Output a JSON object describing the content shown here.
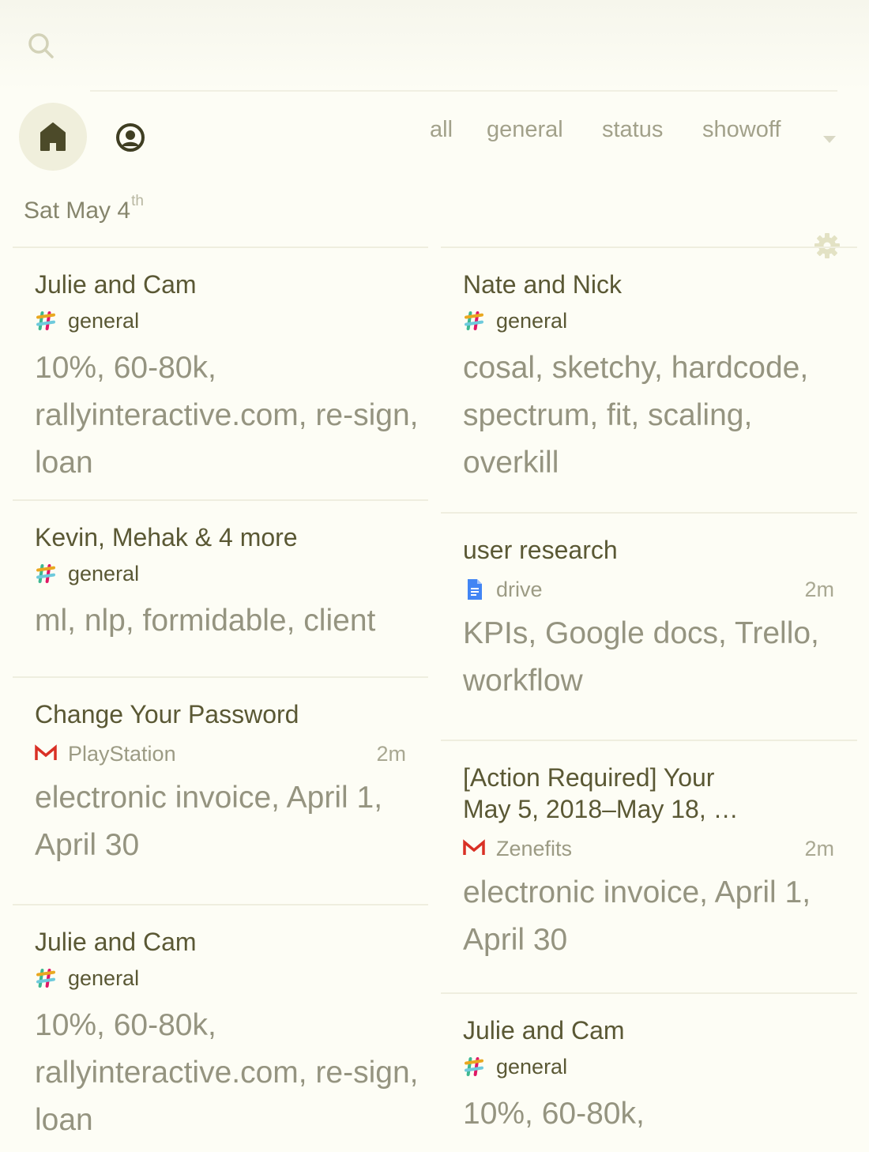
{
  "colors": {
    "background": "#fdfdf5",
    "accent": "#f0efdc",
    "title": "#5a5834",
    "muted": "#959480"
  },
  "nav": {
    "home_icon": "home-icon",
    "profile_icon": "user-circle-icon",
    "search_icon": "search-icon"
  },
  "filters": [
    "all",
    "general",
    "status",
    "showoff"
  ],
  "date": {
    "text": "Sat May 4",
    "suffix": "th"
  },
  "left_column": [
    {
      "title": "Julie and Cam",
      "source_icon": "slack-icon",
      "source": "general",
      "time": "",
      "body": "10%, 60-80k, rallyinteractive.com, re-sign, loan"
    },
    {
      "title": "Kevin, Mehak & 4 more",
      "source_icon": "slack-icon",
      "source": "general",
      "time": "",
      "body": "ml, nlp, formidable, client"
    },
    {
      "title": "Change Your Password",
      "source_icon": "gmail-icon",
      "source": "PlayStation",
      "time": "2m",
      "body": "electronic invoice, April 1, April 30"
    },
    {
      "title": "Julie and Cam",
      "source_icon": "slack-icon",
      "source": "general",
      "time": "",
      "body": "10%, 60-80k, rallyinteractive.com, re-sign, loan"
    }
  ],
  "right_column": [
    {
      "title": "Nate and Nick",
      "source_icon": "slack-icon",
      "source": "general",
      "time": "",
      "body": "cosal, sketchy, hardcode, spectrum, fit, scaling, overkill"
    },
    {
      "title": "user research",
      "source_icon": "google-docs-icon",
      "source": "drive",
      "time": "2m",
      "body": "KPIs, Google docs, Trello, workflow"
    },
    {
      "title_line1": "[Action Required] Your",
      "title_line2": "May 5, 2018–May 18, …",
      "source_icon": "gmail-icon",
      "source": "Zenefits",
      "time": "2m",
      "body": "electronic invoice, April 1, April 30"
    },
    {
      "title": "Julie and Cam",
      "source_icon": "slack-icon",
      "source": "general",
      "time": "",
      "body": "10%, 60-80k,"
    }
  ]
}
